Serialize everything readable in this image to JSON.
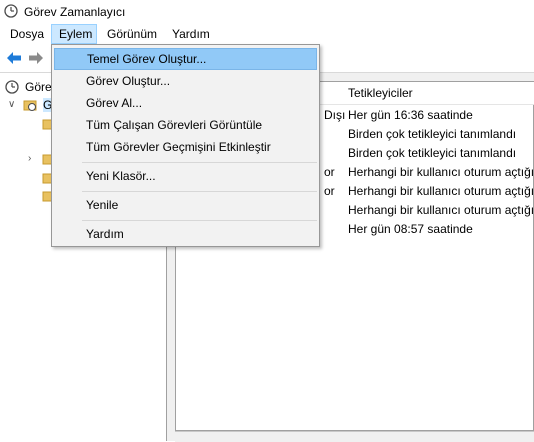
{
  "window": {
    "title": "Görev Zamanlayıcı",
    "icon": "clock-icon"
  },
  "menu": {
    "items": [
      "Dosya",
      "Eylem",
      "Görünüm",
      "Yardım"
    ],
    "active_index": 1
  },
  "toolbar": {
    "icons": [
      "back-arrow-icon",
      "forward-arrow-icon"
    ]
  },
  "tree": {
    "items": [
      {
        "label": "Görev Zamanlayıcı (Yerel)",
        "visible": "Göre",
        "icon": "clock-icon"
      },
      {
        "label": "Görev Zamanlayıcı Kitaplığı",
        "visible": "G",
        "icon": "folder-clock-icon"
      }
    ]
  },
  "dropdown": {
    "items": [
      {
        "label": "Temel Görev Oluştur..."
      },
      {
        "label": "Görev Oluştur..."
      },
      {
        "label": "Görev Al..."
      },
      {
        "label": "Tüm Çalışan Görevleri Görüntüle"
      },
      {
        "label": "Tüm Görevler Geçmişini Etkinleştir"
      },
      {
        "label": "Yeni Klasör..."
      },
      {
        "label": "Yenile"
      },
      {
        "label": "Yardım"
      }
    ],
    "highlight_index": 0
  },
  "table": {
    "header": {
      "triggers": "Tetikleyiciler"
    },
    "rows": [
      {
        "status_partial": "Dışı",
        "trigger": "Her gün 16:36 saatinde"
      },
      {
        "status_partial": "",
        "trigger": "Birden çok tetikleyici tanımlandı"
      },
      {
        "status_partial": "",
        "trigger": "Birden çok tetikleyici tanımlandı"
      },
      {
        "status_partial": "or",
        "trigger": "Herhangi bir kullanıcı oturum açtığı"
      },
      {
        "status_partial": "or",
        "trigger": "Herhangi bir kullanıcı oturum açtığı"
      },
      {
        "status_partial": "",
        "trigger": "Herhangi bir kullanıcı oturum açtığı"
      },
      {
        "status_partial": "",
        "trigger": "Her gün 08:57 saatinde"
      }
    ]
  },
  "colors": {
    "highlight": "#91c9f7",
    "menu_active": "#cce8ff",
    "accent": "#1e7bd8"
  }
}
